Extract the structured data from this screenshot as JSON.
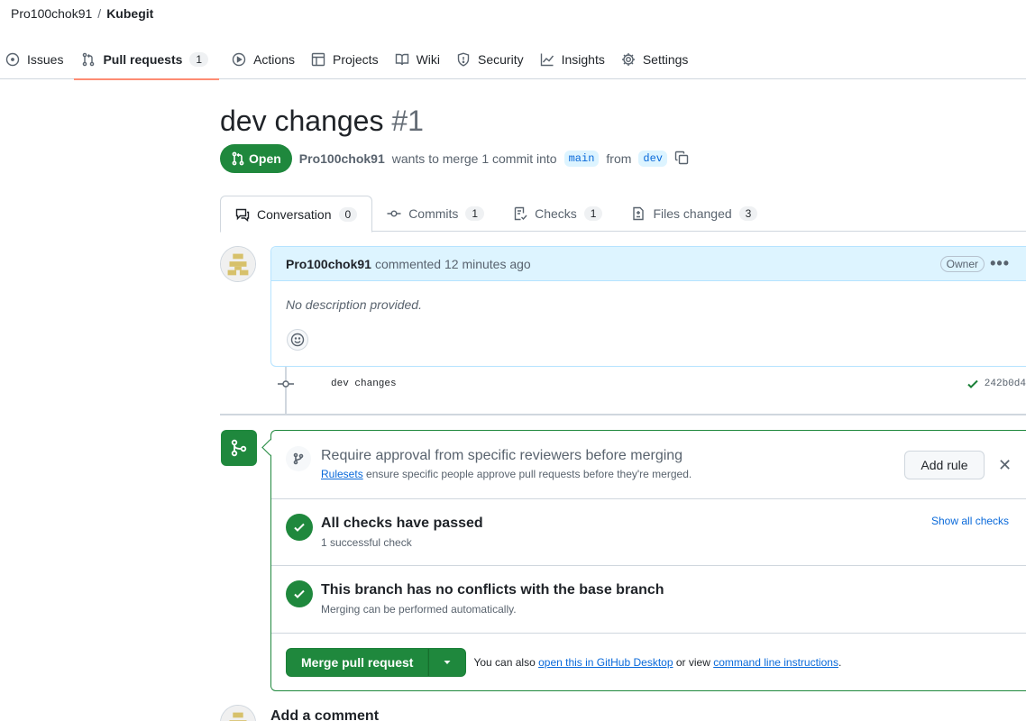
{
  "breadcrumb": {
    "owner": "Pro100chok91",
    "separator": "/",
    "repo": "Kubegit"
  },
  "nav": [
    {
      "label": "Issues",
      "icon": "issue-icon"
    },
    {
      "label": "Pull requests",
      "icon": "pull-request-icon",
      "count": "1",
      "active": true
    },
    {
      "label": "Actions",
      "icon": "play-icon"
    },
    {
      "label": "Projects",
      "icon": "table-icon"
    },
    {
      "label": "Wiki",
      "icon": "book-icon"
    },
    {
      "label": "Security",
      "icon": "shield-icon"
    },
    {
      "label": "Insights",
      "icon": "graph-icon"
    },
    {
      "label": "Settings",
      "icon": "gear-icon"
    }
  ],
  "pr": {
    "title": "dev changes",
    "number": "#1",
    "state": "Open",
    "author": "Pro100chok91",
    "merge_text": "wants to merge 1 commit into",
    "base_branch": "main",
    "from_text": "from",
    "head_branch": "dev"
  },
  "tabs": [
    {
      "label": "Conversation",
      "count": "0",
      "icon": "comment-icon",
      "active": true
    },
    {
      "label": "Commits",
      "count": "1",
      "icon": "commit-icon"
    },
    {
      "label": "Checks",
      "count": "1",
      "icon": "checklist-icon"
    },
    {
      "label": "Files changed",
      "count": "3",
      "icon": "file-diff-icon"
    }
  ],
  "comment": {
    "author": "Pro100chok91",
    "action": "commented 12 minutes ago",
    "badge": "Owner",
    "body": "No description provided."
  },
  "commit": {
    "message": "dev changes",
    "sha": "242b0d4"
  },
  "merge_box": {
    "rule_title": "Require approval from specific reviewers before merging",
    "rule_link": "Rulesets",
    "rule_sub": "ensure specific people approve pull requests before they're merged.",
    "add_rule": "Add rule",
    "close": "✕",
    "checks_title": "All checks have passed",
    "checks_sub": "1 successful check",
    "show_all": "Show all checks",
    "conflicts_title": "This branch has no conflicts with the base branch",
    "conflicts_sub": "Merging can be performed automatically.",
    "merge_button": "Merge pull request",
    "hint_prefix": "You can also",
    "hint_link1": "open this in GitHub Desktop",
    "hint_mid": "or view",
    "hint_link2": "command line instructions",
    "hint_suffix": "."
  },
  "add_comment_title": "Add a comment",
  "colors": {
    "green": "#1f883d",
    "link": "#0969da",
    "active_tab_underline": "#fd8c73",
    "comment_header": "#ddf4ff"
  }
}
